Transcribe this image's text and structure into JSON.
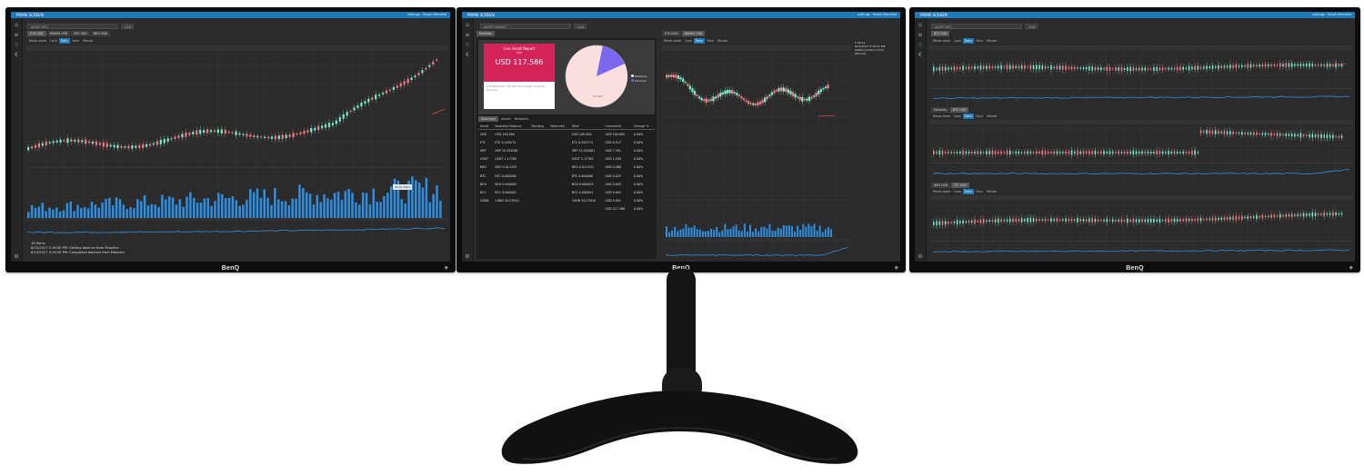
{
  "brand": "BenQ",
  "colors": {
    "accent": "#1d7ab8",
    "candle_up": "#7ce8c8",
    "candle_down": "#f07a85",
    "volume": "#2f8ee0",
    "line": "#2f8ee0",
    "report": "#d4245a",
    "pie_main": "#fbdede",
    "pie_slice": "#7b68ee"
  },
  "left": {
    "window_title": "PRIME SCREEN",
    "window_right": "settings  ·  Ralph Mendelo",
    "search_placeholder": "ASSET BTC",
    "search_currency": "USD",
    "tabs": [
      "ETH USD",
      "WAVES USD",
      "BTC USD",
      "NEO USD"
    ],
    "controls": [
      "Reset zoom",
      "Lock",
      "Daily",
      "Hour",
      "Minute"
    ],
    "tooltip": "93.01.0001",
    "log_title": "16 Items",
    "log_lines": [
      "8/15/2017 5:16:50 PM: Getting balance from Poloniex",
      "8/15/2017 5:16:50 PM: Completed balance from Poloniex"
    ]
  },
  "center": {
    "window_title": "PRIME SCREEN",
    "window_right": "settings  ·  Ralph Mendelo",
    "search_placeholder": "ASSET WAVES",
    "search_currency": "USD",
    "portfolio_tab": "Portfolio",
    "report": {
      "title": "Live Asset Report",
      "subtitle": "USD",
      "value": "USD 117.586",
      "note": "Use Bittersby: Wendie, Exchange, Analysis, Poloniex"
    },
    "pie": {
      "legend": [
        "Bitstamp",
        "Poloniex"
      ],
      "label": "16,486"
    },
    "table_tabs": [
      "Summary",
      "Assets",
      "Networks"
    ],
    "table_headers": [
      "Asset",
      "Available Balance",
      "Pending",
      "Reserved",
      "Total",
      "Converted",
      "Change %"
    ],
    "table_rows": [
      [
        "USD",
        "USD 100.000",
        "",
        "",
        "USD 100.000",
        "USD 100.000",
        "0.00%"
      ],
      [
        "ETC",
        "ETC 0.545274",
        "",
        "",
        "ETC 0.545274",
        "USD 8.517",
        "0.00%"
      ],
      [
        "XRP",
        "XRP 25.554061",
        "",
        "",
        "XRP 25.554061",
        "USD 7.381",
        "0.00%"
      ],
      [
        "USDT",
        "USDT 1.17765",
        "",
        "",
        "USDT 1.17765",
        "USD 1.189",
        "0.00%"
      ],
      [
        "NEO",
        "NEO 0.011335",
        "",
        "",
        "NEO 0.011335",
        "USD 0.468",
        "0.00%"
      ],
      [
        "BTC",
        "BTC 0.000006",
        "",
        "",
        "BTC 0.000006",
        "USD 0.025",
        "0.00%"
      ],
      [
        "BCH",
        "BCH 0.000003",
        "",
        "",
        "BCH 0.000003",
        "USD 0.003",
        "0.00%"
      ],
      [
        "BCC",
        "BCC 0.000001",
        "",
        "",
        "BCC 0.000001",
        "USD 0.001",
        "0.00%"
      ],
      [
        "CANN",
        "CANN 50.23910",
        "",
        "",
        "CANN 50.23910",
        "USD 0.001",
        "0.00%"
      ],
      [
        "",
        "",
        "",
        "",
        "",
        "USD 117.586",
        "0.00%"
      ]
    ],
    "chart_tabs": [
      "ETH USD",
      "WAVES USD"
    ],
    "chart_controls": [
      "Reset zoom",
      "Lock",
      "Daily",
      "Hour",
      "Minute"
    ],
    "side_title": "6 Items",
    "side_lines": [
      "8/15/2017 5:16:57 PM: Getting balance from Poloniex"
    ]
  },
  "right": {
    "window_title": "PRIME SCREEN",
    "window_right": "settings  ·  Ralph Mendelo",
    "search_placeholder": "ASSET BTC",
    "search_currency": "USD",
    "tab_top": "BTC USD",
    "controls": [
      "Reset zoom",
      "Lock",
      "Daily",
      "Hour",
      "Minute"
    ],
    "tabs_mid": [
      "Services",
      "BTC USD"
    ],
    "tabs_bottom": [
      "NEO USD",
      "LTC USD"
    ]
  }
}
